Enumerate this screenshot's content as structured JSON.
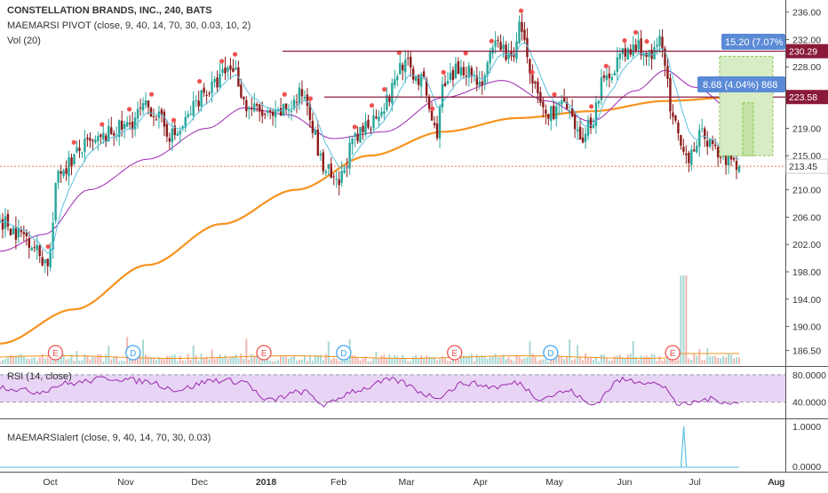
{
  "legend": {
    "title": "CONSTELLATION BRANDS, INC., 240, BATS",
    "indicator": "MAEMARSI PIVOT (close, 9, 40, 14, 70, 30, 0.03, 10, 2)",
    "volume": "Vol (20)"
  },
  "rsi_label": "RSI (14, close)",
  "alert_label": "MAEMARSIalert (close, 9, 40, 14, 70, 30, 0.03)",
  "colors": {
    "up": "#26a69a",
    "down": "#8b1a1a",
    "ema_fast": "#5bc0de",
    "ema_mid": "#9c27b0",
    "ema_slow": "#f7931e",
    "resistance": "#8b1a3a",
    "rsi": "#9c27b0",
    "rsi_band": "#e8d5f5",
    "pivot_dot": "#ef5350",
    "event_e": "#ef5350",
    "event_d": "#42a5f5",
    "price_tag": "#e8501c",
    "level_tag": "#8b1a3a",
    "measure_box": "#5b8ad6",
    "measure_fill": "#d7ecc5"
  },
  "chart_data": {
    "type": "candlestick",
    "ticker": "CONSTELLATION BRANDS, INC.",
    "interval": "240",
    "exchange": "BATS",
    "ylim": [
      185,
      237
    ],
    "x_tick_labels": [
      "Oct",
      "Nov",
      "Dec",
      "2018",
      "Feb",
      "Mar",
      "Apr",
      "May",
      "Jun",
      "Jul",
      "Aug"
    ],
    "y_tick_labels": [
      "236.00",
      "232.00",
      "228.00",
      "219.00",
      "215.00",
      "210.00",
      "206.00",
      "202.00",
      "198.00",
      "194.00",
      "190.00",
      "186.50"
    ],
    "last_price": "213.45",
    "levels": [
      {
        "label": "230.29",
        "value": 230.29
      },
      {
        "label": "223.58",
        "value": 223.58
      }
    ],
    "measurements": [
      {
        "label": "15.20 (7.07%",
        "value": 15.2
      },
      {
        "label": "8.68 (4.04%)",
        "value": 8.68,
        "suffix": "868"
      }
    ],
    "close_anchors": [
      {
        "t": 0,
        "v": 205.5
      },
      {
        "t": 0.03,
        "v": 203.5
      },
      {
        "t": 0.065,
        "v": 199.5
      },
      {
        "t": 0.08,
        "v": 213.0
      },
      {
        "t": 0.12,
        "v": 216.5
      },
      {
        "t": 0.165,
        "v": 219.0
      },
      {
        "t": 0.2,
        "v": 222.0
      },
      {
        "t": 0.235,
        "v": 218.0
      },
      {
        "t": 0.28,
        "v": 224.5
      },
      {
        "t": 0.315,
        "v": 228.0
      },
      {
        "t": 0.335,
        "v": 222.0
      },
      {
        "t": 0.37,
        "v": 220.5
      },
      {
        "t": 0.39,
        "v": 222.0
      },
      {
        "t": 0.41,
        "v": 224.0
      },
      {
        "t": 0.44,
        "v": 213.0
      },
      {
        "t": 0.455,
        "v": 210.5
      },
      {
        "t": 0.48,
        "v": 217.0
      },
      {
        "t": 0.5,
        "v": 220.0
      },
      {
        "t": 0.52,
        "v": 222.5
      },
      {
        "t": 0.545,
        "v": 228.5
      },
      {
        "t": 0.57,
        "v": 226.0
      },
      {
        "t": 0.59,
        "v": 218.5
      },
      {
        "t": 0.6,
        "v": 225.0
      },
      {
        "t": 0.625,
        "v": 228.0
      },
      {
        "t": 0.65,
        "v": 226.0
      },
      {
        "t": 0.675,
        "v": 231.5
      },
      {
        "t": 0.69,
        "v": 229.0
      },
      {
        "t": 0.705,
        "v": 234.0
      },
      {
        "t": 0.72,
        "v": 225.0
      },
      {
        "t": 0.74,
        "v": 221.0
      },
      {
        "t": 0.76,
        "v": 222.5
      },
      {
        "t": 0.785,
        "v": 217.5
      },
      {
        "t": 0.8,
        "v": 220.0
      },
      {
        "t": 0.815,
        "v": 225.5
      },
      {
        "t": 0.84,
        "v": 229.5
      },
      {
        "t": 0.865,
        "v": 231.0
      },
      {
        "t": 0.88,
        "v": 229.0
      },
      {
        "t": 0.895,
        "v": 232.0
      },
      {
        "t": 0.91,
        "v": 220.0
      },
      {
        "t": 0.925,
        "v": 214.5
      },
      {
        "t": 0.95,
        "v": 218.0
      },
      {
        "t": 0.975,
        "v": 215.0
      },
      {
        "t": 1.0,
        "v": 213.45
      }
    ],
    "ema_slow_anchors": [
      {
        "t": 0,
        "v": 187.5
      },
      {
        "t": 0.1,
        "v": 192.5
      },
      {
        "t": 0.2,
        "v": 199.0
      },
      {
        "t": 0.3,
        "v": 205.0
      },
      {
        "t": 0.4,
        "v": 210.0
      },
      {
        "t": 0.5,
        "v": 215.0
      },
      {
        "t": 0.6,
        "v": 218.5
      },
      {
        "t": 0.7,
        "v": 220.5
      },
      {
        "t": 0.8,
        "v": 221.5
      },
      {
        "t": 0.9,
        "v": 223.0
      },
      {
        "t": 1.0,
        "v": 223.58
      }
    ],
    "ema_mid_anchors": [
      {
        "t": 0,
        "v": 201.0
      },
      {
        "t": 0.06,
        "v": 203.5
      },
      {
        "t": 0.12,
        "v": 210.0
      },
      {
        "t": 0.2,
        "v": 214.5
      },
      {
        "t": 0.28,
        "v": 219.0
      },
      {
        "t": 0.33,
        "v": 222.0
      },
      {
        "t": 0.39,
        "v": 221.0
      },
      {
        "t": 0.45,
        "v": 217.5
      },
      {
        "t": 0.52,
        "v": 218.5
      },
      {
        "t": 0.6,
        "v": 223.5
      },
      {
        "t": 0.68,
        "v": 226.0
      },
      {
        "t": 0.74,
        "v": 223.0
      },
      {
        "t": 0.8,
        "v": 220.0
      },
      {
        "t": 0.86,
        "v": 224.5
      },
      {
        "t": 0.9,
        "v": 227.5
      },
      {
        "t": 0.94,
        "v": 225.0
      },
      {
        "t": 1.0,
        "v": 221.0
      }
    ],
    "rsi": {
      "levels_labels": [
        "80.0000",
        "40.0000"
      ],
      "ylim": [
        20,
        85
      ],
      "anchors": [
        {
          "t": 0,
          "v": 62
        },
        {
          "t": 0.05,
          "v": 55
        },
        {
          "t": 0.09,
          "v": 67
        },
        {
          "t": 0.15,
          "v": 75
        },
        {
          "t": 0.2,
          "v": 70
        },
        {
          "t": 0.24,
          "v": 58
        },
        {
          "t": 0.29,
          "v": 72
        },
        {
          "t": 0.33,
          "v": 70
        },
        {
          "t": 0.36,
          "v": 42
        },
        {
          "t": 0.41,
          "v": 55
        },
        {
          "t": 0.44,
          "v": 36
        },
        {
          "t": 0.48,
          "v": 57
        },
        {
          "t": 0.53,
          "v": 72
        },
        {
          "t": 0.59,
          "v": 48
        },
        {
          "t": 0.63,
          "v": 68
        },
        {
          "t": 0.67,
          "v": 62
        },
        {
          "t": 0.7,
          "v": 68
        },
        {
          "t": 0.73,
          "v": 46
        },
        {
          "t": 0.77,
          "v": 56
        },
        {
          "t": 0.8,
          "v": 36
        },
        {
          "t": 0.84,
          "v": 72
        },
        {
          "t": 0.88,
          "v": 70
        },
        {
          "t": 0.9,
          "v": 60
        },
        {
          "t": 0.92,
          "v": 35
        },
        {
          "t": 0.96,
          "v": 44
        },
        {
          "t": 1.0,
          "v": 38
        }
      ]
    },
    "alert": {
      "levels_labels": [
        "1.0000",
        "0.0000"
      ],
      "spike_t": 0.925
    },
    "events": [
      {
        "type": "E",
        "t": 0.075
      },
      {
        "type": "D",
        "t": 0.18
      },
      {
        "type": "E",
        "t": 0.357
      },
      {
        "type": "D",
        "t": 0.465
      },
      {
        "type": "E",
        "t": 0.615
      },
      {
        "type": "D",
        "t": 0.745
      },
      {
        "type": "E",
        "t": 0.91
      }
    ]
  }
}
